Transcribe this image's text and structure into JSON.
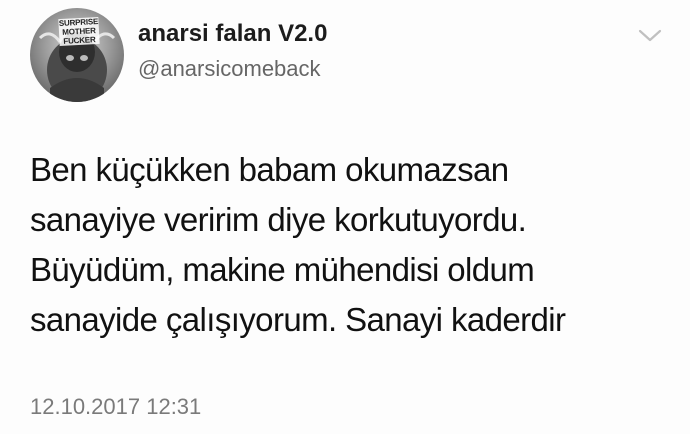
{
  "author": {
    "display_name": "anarsi falan V2.0",
    "handle": "@anarsicomeback",
    "avatar_text": [
      "SURPRISE",
      "MOTHER",
      "FUCKER"
    ]
  },
  "tweet": {
    "lines": [
      "Ben küçükken babam okumazsan",
      "sanayiye veririm diye korkutuyordu.",
      "Büyüdüm, makine mühendisi oldum",
      "sanayide çalışıyorum. Sanayi kaderdir"
    ],
    "timestamp": "12.10.2017 12:31"
  },
  "icons": {
    "menu": "chevron-down-icon",
    "avatar": "avatar-image"
  },
  "colors": {
    "text": "#111111",
    "secondary": "#666666",
    "chevron": "#c0c0c0"
  }
}
